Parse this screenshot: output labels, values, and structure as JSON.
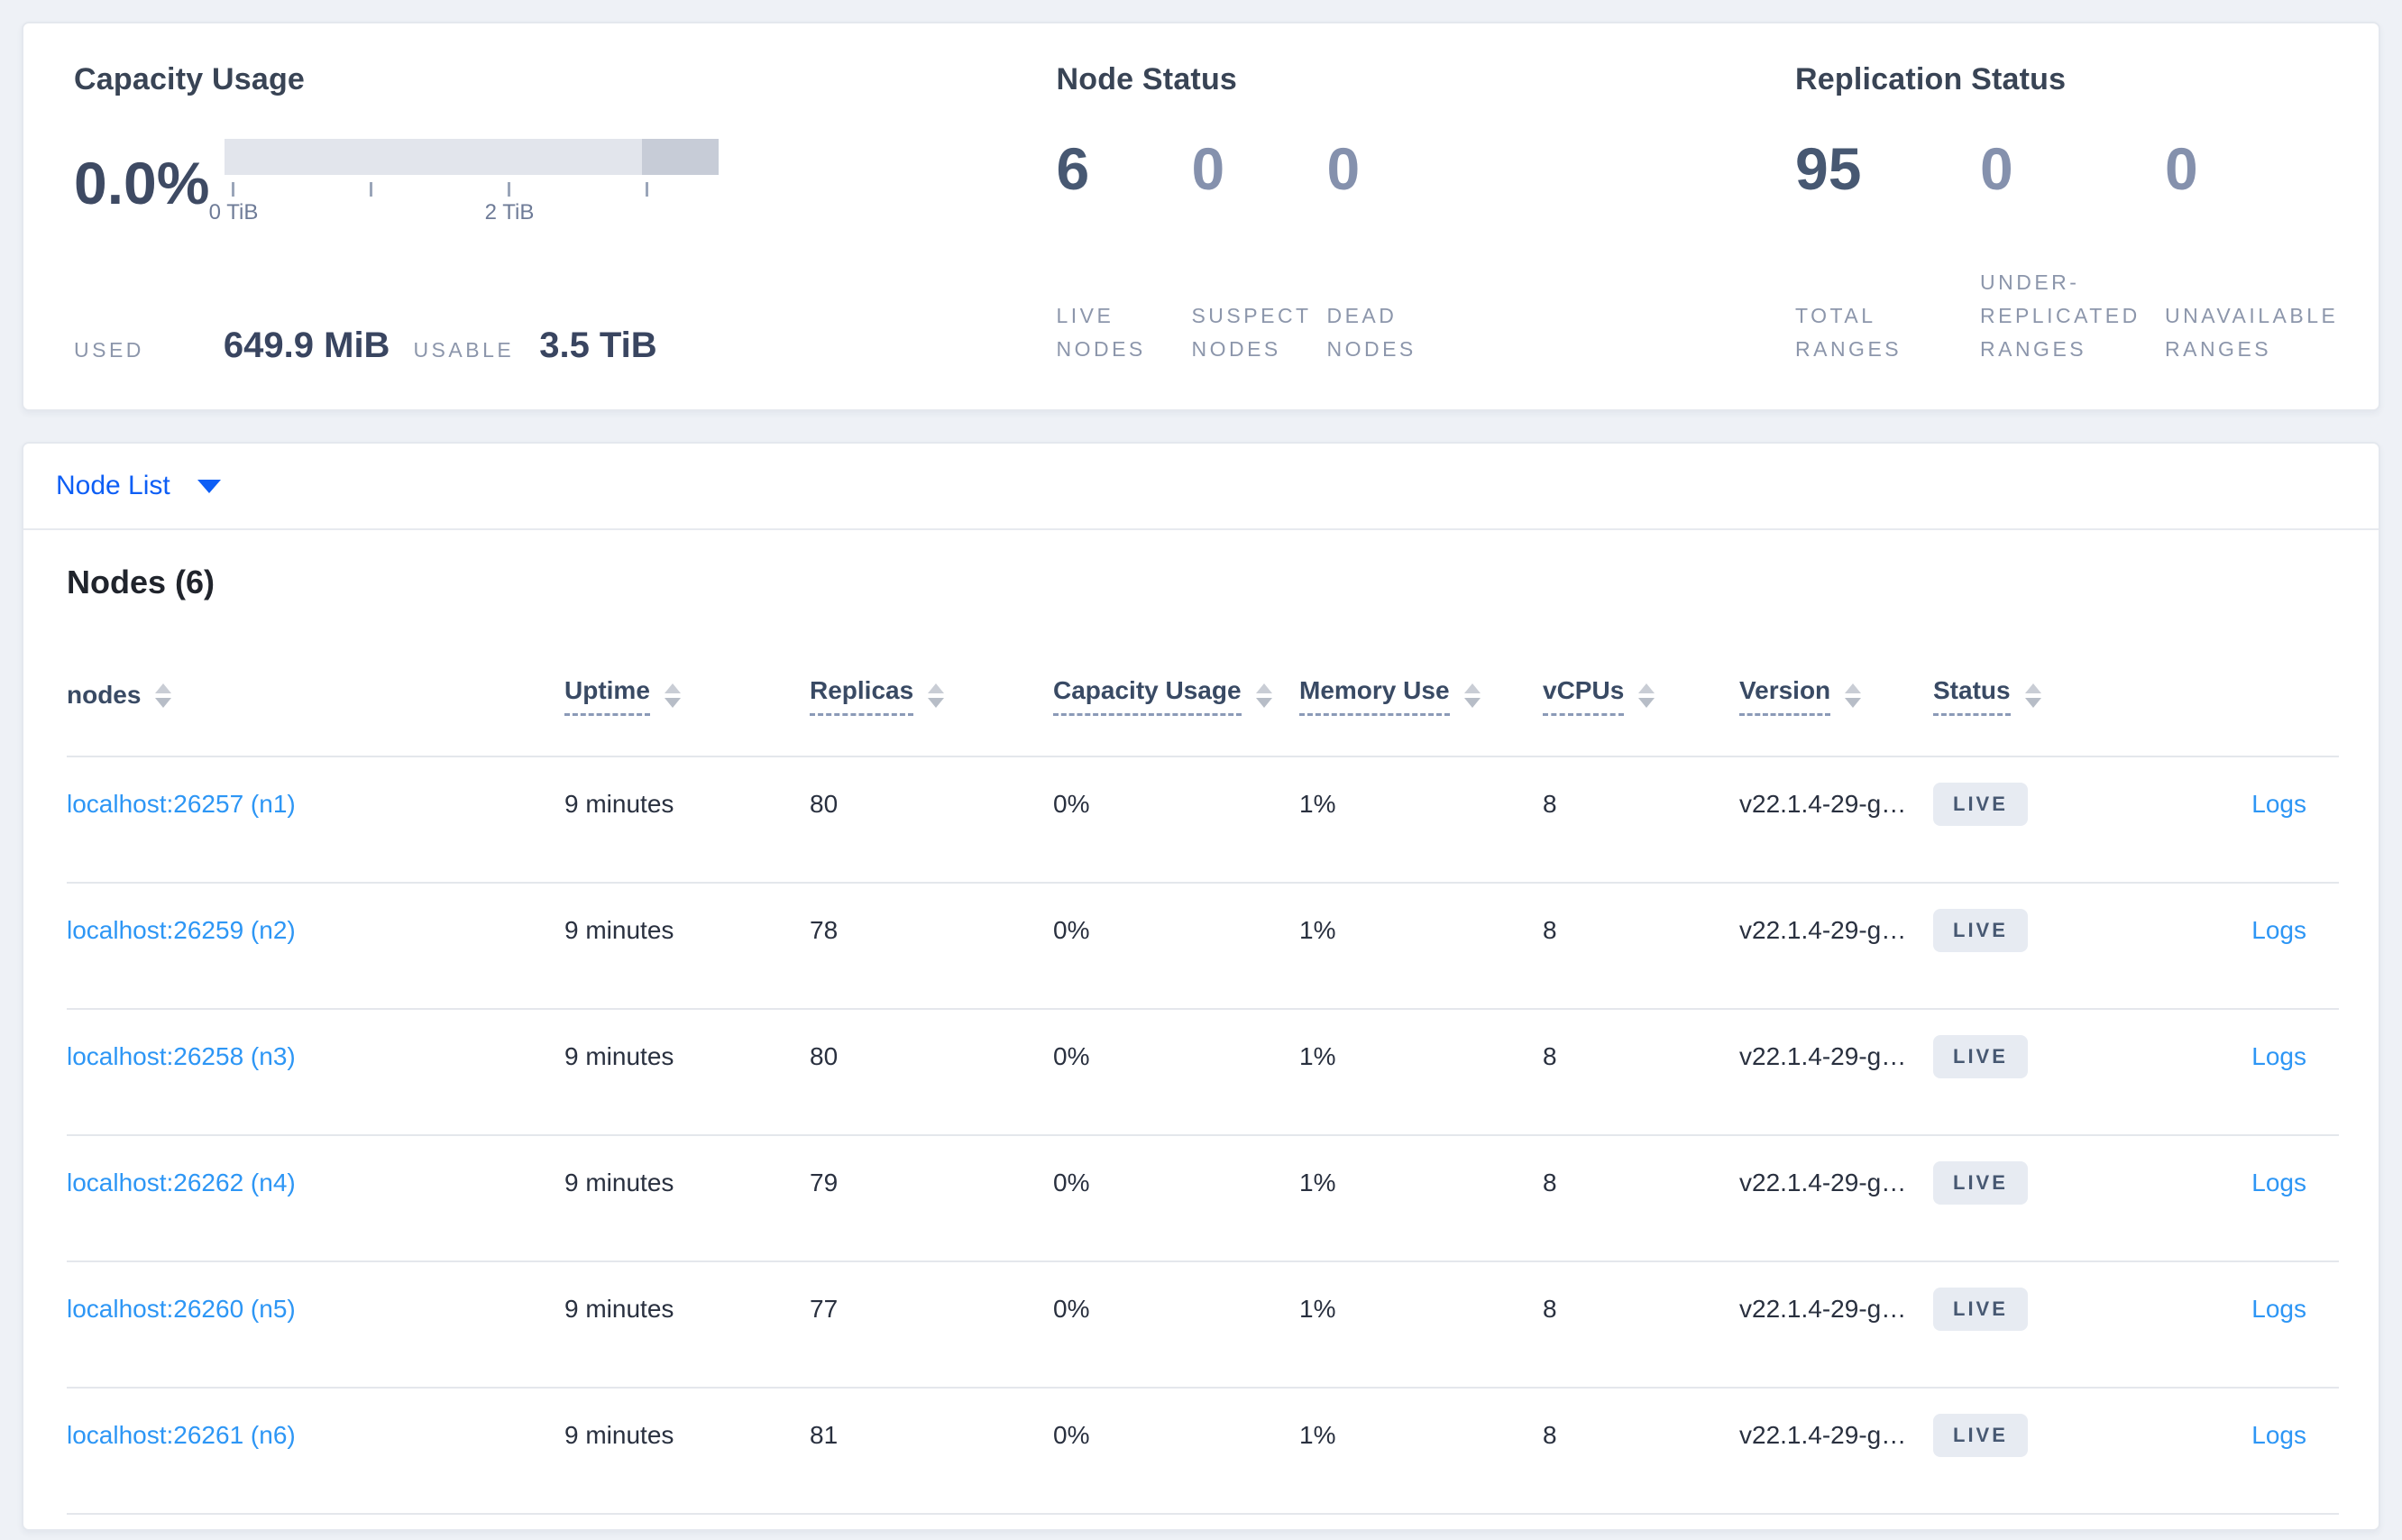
{
  "summary": {
    "capacity": {
      "title": "Capacity Usage",
      "percent": "0.0%",
      "tick_labels": [
        "0 TiB",
        "2 TiB"
      ],
      "used_label": "USED",
      "used_value": "649.9 MiB",
      "usable_label": "USABLE",
      "usable_value": "3.5 TiB"
    },
    "node_status": {
      "title": "Node Status",
      "stats": [
        {
          "value": "6",
          "label": "LIVE NODES"
        },
        {
          "value": "0",
          "label": "SUSPECT NODES"
        },
        {
          "value": "0",
          "label": "DEAD NODES"
        }
      ]
    },
    "replication_status": {
      "title": "Replication Status",
      "stats": [
        {
          "value": "95",
          "label": "TOTAL RANGES"
        },
        {
          "value": "0",
          "label": "UNDER-REPLICATED RANGES"
        },
        {
          "value": "0",
          "label": "UNAVAILABLE RANGES"
        }
      ]
    }
  },
  "view_selector": {
    "label": "Node List",
    "caret_icon": "caret-down"
  },
  "nodes_table": {
    "title": "Nodes (6)",
    "columns": [
      {
        "label": "nodes"
      },
      {
        "label": "Uptime"
      },
      {
        "label": "Replicas"
      },
      {
        "label": "Capacity Usage"
      },
      {
        "label": "Memory Use"
      },
      {
        "label": "vCPUs"
      },
      {
        "label": "Version"
      },
      {
        "label": "Status"
      }
    ],
    "logs_label": "Logs",
    "rows": [
      {
        "address": "localhost:26257 (n1)",
        "uptime": "9 minutes",
        "replicas": "80",
        "capacity_usage": "0%",
        "memory_use": "1%",
        "vcpus": "8",
        "version": "v22.1.4-29-g…",
        "status": "LIVE"
      },
      {
        "address": "localhost:26259 (n2)",
        "uptime": "9 minutes",
        "replicas": "78",
        "capacity_usage": "0%",
        "memory_use": "1%",
        "vcpus": "8",
        "version": "v22.1.4-29-g…",
        "status": "LIVE"
      },
      {
        "address": "localhost:26258 (n3)",
        "uptime": "9 minutes",
        "replicas": "80",
        "capacity_usage": "0%",
        "memory_use": "1%",
        "vcpus": "8",
        "version": "v22.1.4-29-g…",
        "status": "LIVE"
      },
      {
        "address": "localhost:26262 (n4)",
        "uptime": "9 minutes",
        "replicas": "79",
        "capacity_usage": "0%",
        "memory_use": "1%",
        "vcpus": "8",
        "version": "v22.1.4-29-g…",
        "status": "LIVE"
      },
      {
        "address": "localhost:26260 (n5)",
        "uptime": "9 minutes",
        "replicas": "77",
        "capacity_usage": "0%",
        "memory_use": "1%",
        "vcpus": "8",
        "version": "v22.1.4-29-g…",
        "status": "LIVE"
      },
      {
        "address": "localhost:26261 (n6)",
        "uptime": "9 minutes",
        "replicas": "81",
        "capacity_usage": "0%",
        "memory_use": "1%",
        "vcpus": "8",
        "version": "v22.1.4-29-g…",
        "status": "LIVE"
      }
    ]
  },
  "colors": {
    "page_bg": "#eef1f6",
    "accent_blue": "#0d5ef5",
    "link_blue": "#2d96f5",
    "heading_slate": "#394455",
    "number_slate": "#475872",
    "muted_number": "#8591ad",
    "muted_label": "#8c96ab",
    "badge_bg": "#e7ebf2",
    "badge_text": "#475872",
    "bar_track": "#e2e5ec",
    "bar_segment_dark": "#c7ccd7"
  }
}
